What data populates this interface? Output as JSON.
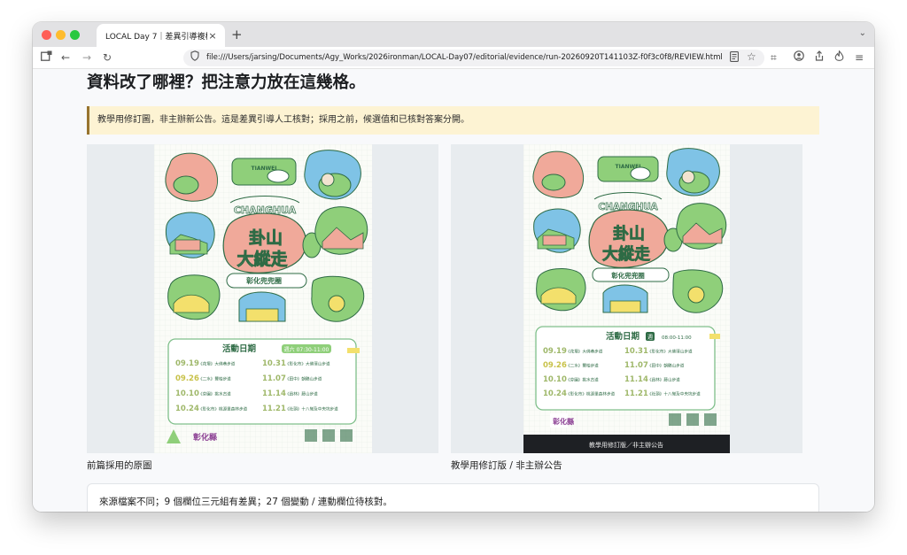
{
  "browser": {
    "tab_title": "LOCAL Day 7｜差異引導複核",
    "tab_close": "×",
    "new_tab": "+",
    "tab_menu": "⌄",
    "url": "file:///Users/jarsing/Documents/Agy_Works/2026ironman/LOCAL-Day07/editorial/evidence/run-20260920T141103Z-f0f3c0f8/REVIEW.html",
    "icons": [
      "sidebar-icon",
      "back-arrow-icon",
      "forward-arrow-icon",
      "reload-icon",
      "shield-icon",
      "reader-mode-icon",
      "bookmark-star-icon",
      "crop-icon",
      "account-icon",
      "share-icon",
      "extension-icon",
      "menu-icon"
    ]
  },
  "page": {
    "title": "資料改了哪裡？把注意力放在這幾格。",
    "notice": "教學用修訂圖，非主辦新公告。這是差異引導人工核對；採用之前，候選值和已核對答案分開。",
    "notice_colors": {
      "background": "#fdf3d3",
      "border": "#97742f"
    },
    "left_caption": "前篇採用的原圖",
    "right_caption": "教學用修訂版 / 非主辦公告",
    "summary": "來源檔案不同；9 個欄位三元組有差異；27 個變動 / 連動欄位待核對。"
  },
  "posters": {
    "left": {
      "changhua_label": "CHANGHUA",
      "main_title_line1": "卦山",
      "main_title_line2": "大縱走",
      "subtitle": "彰化兜兜圈",
      "schedule_heading": "活動日期",
      "time_badge": "週六 07:30-11:00",
      "rows": [
        {
          "date": "09.19",
          "route": "《花壇》大佛巷步道"
        },
        {
          "date": "10.31",
          "route": "《彰化市》大佛環山步道"
        },
        {
          "date": "09.26",
          "route": "《二水》豐柏步道"
        },
        {
          "date": "11.07",
          "route": "《田中》朝鶴山步道"
        },
        {
          "date": "10.10",
          "route": "《芬園》挑水古道"
        },
        {
          "date": "11.14",
          "route": "《員林》藤山步道"
        },
        {
          "date": "10.24",
          "route": "《彰化市》桃源里森林步道"
        },
        {
          "date": "11.21",
          "route": "《社頭》十八彎及中央坑步道"
        }
      ],
      "logo_text": "彰化縣"
    },
    "right": {
      "changhua_label": "CHANGHUA",
      "main_title_line1": "卦山",
      "main_title_line2": "大縱走",
      "subtitle": "彰化兜兜圈",
      "schedule_heading": "活動日期",
      "time_badge": "週",
      "time_text": "08:00-11:00",
      "rows": [
        {
          "date": "09.19",
          "route": "《花壇》大佛巷步道"
        },
        {
          "date": "10.31",
          "route": "《彰化市》大佛環山步道"
        },
        {
          "date": "09.26",
          "route": "《二水》豐柏步道"
        },
        {
          "date": "11.07",
          "route": "《田中》朝鶴山步道"
        },
        {
          "date": "10.10",
          "route": "《芬園》挑水古道"
        },
        {
          "date": "11.14",
          "route": "《員林》藤山步道"
        },
        {
          "date": "10.24",
          "route": "《彰化市》桃源里森林步道"
        },
        {
          "date": "11.21",
          "route": "《社頭》十八彎及中央坑步道"
        }
      ],
      "footer_banner": "教學用修訂版／非主辦公告",
      "logo_text": "彰化縣"
    },
    "colors": {
      "pink": "#f0a99a",
      "green": "#8fcf7a",
      "blue": "#7fc3e6",
      "yellow": "#f3e06c",
      "dark_green": "#2e6b45",
      "date_text": "#9fb86a",
      "date_highlight": "#c8c24a",
      "banner": "#1e2024"
    }
  }
}
